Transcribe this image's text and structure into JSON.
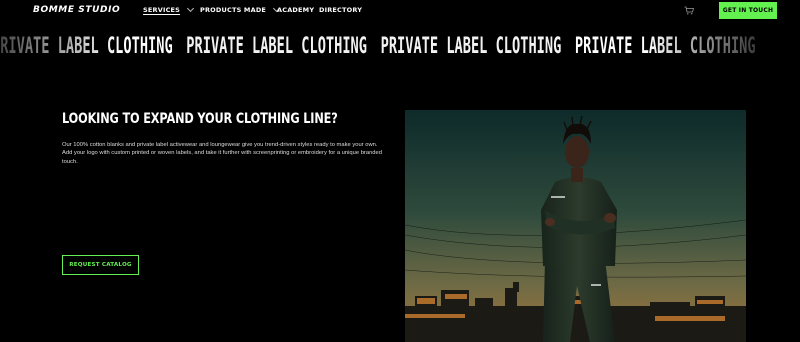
{
  "nav": {
    "logo": "BOMME STUDIO",
    "items": [
      {
        "label": "SERVICES",
        "active": true,
        "dropdown": true
      },
      {
        "label": "PRODUCTS MADE",
        "active": false,
        "dropdown": true
      },
      {
        "label": "ACADEMY",
        "active": false,
        "dropdown": false
      },
      {
        "label": "DIRECTORY",
        "active": false,
        "dropdown": false
      }
    ],
    "cart_icon": "cart-icon",
    "cta_label": "GET IN TOUCH",
    "cta_color": "#63f14f"
  },
  "marquee": {
    "items": [
      "PRIVATE LABEL CLOTHING",
      "PRIVATE LABEL CLOTHING",
      "PRIVATE LABEL CLOTHING",
      "PRIVATE LABEL CLOTHING"
    ]
  },
  "hero": {
    "headline": "LOOKING TO EXPAND YOUR CLOTHING LINE?",
    "body": "Our 100% cotton blanks and private label activewear and loungewear give you trend-driven styles ready to make your own. Add your logo with custom printed or woven labels, and take it further with screenprinting or embroidery for a unique branded touch.",
    "button_label": "REQUEST CATALOG",
    "accent": "#63f14f"
  }
}
